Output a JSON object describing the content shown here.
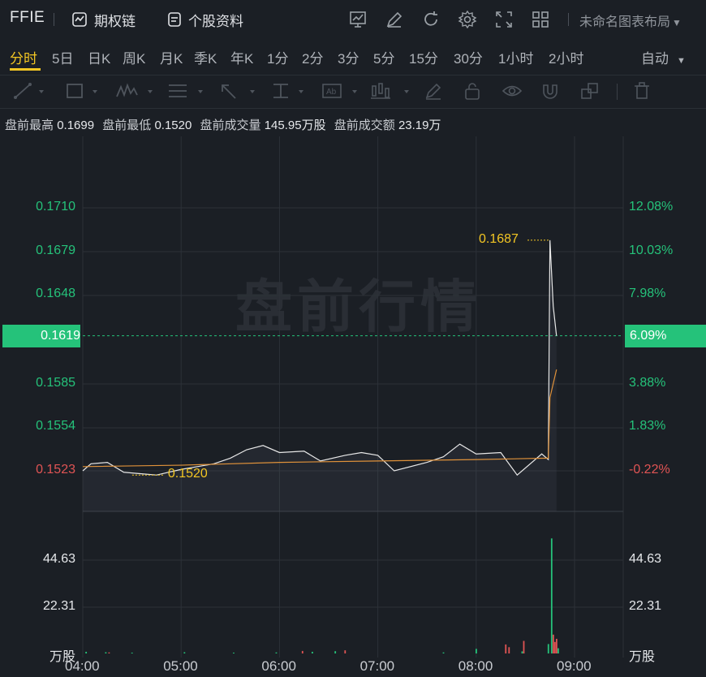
{
  "header": {
    "ticker": "FFIE",
    "options_chain": "期权链",
    "stock_info": "个股资料",
    "layout_name": "未命名图表布局",
    "icons": [
      "indicator-icon",
      "draw-icon",
      "refresh-icon",
      "settings-icon",
      "fullscreen-icon",
      "grid-icon"
    ]
  },
  "tabs": {
    "items": [
      "分时",
      "5日",
      "日K",
      "周K",
      "月K",
      "季K",
      "年K",
      "1分",
      "2分",
      "3分",
      "5分",
      "15分",
      "30分",
      "1小时",
      "2小时"
    ],
    "active": "分时",
    "auto": "自动"
  },
  "info": {
    "high_label": "盘前最高",
    "high": "0.1699",
    "low_label": "盘前最低",
    "low": "0.1520",
    "vol_label": "盘前成交量",
    "vol": "145.95万股",
    "amt_label": "盘前成交额",
    "amt": "23.19万"
  },
  "chart": {
    "watermark": "盘前行情",
    "price_left": [
      "0.1710",
      "0.1679",
      "0.1648",
      "0.1585",
      "0.1554",
      "0.1523"
    ],
    "price_right": [
      "12.08%",
      "10.03%",
      "7.98%",
      "3.88%",
      "1.83%",
      "-0.22%"
    ],
    "current_price": "0.1619",
    "current_pct": "6.09%",
    "high_annotation": "0.1687",
    "low_annotation": "0.1520",
    "vol_left": [
      "44.63",
      "22.31",
      "万股"
    ],
    "vol_right": [
      "44.63",
      "22.31",
      "万股"
    ],
    "x_labels": [
      "04:00",
      "05:00",
      "06:00",
      "07:00",
      "08:00",
      "09:00"
    ],
    "colors": {
      "up": "#25c27a",
      "down": "#e05454",
      "avg": "#e0923a",
      "price": "#e8e8e8",
      "highlight": "#f3c623"
    }
  },
  "chart_data": {
    "type": "line",
    "title": "",
    "x_range": [
      "04:00",
      "09:00"
    ],
    "ylim": [
      0.151,
      0.172
    ],
    "series": [
      {
        "name": "price",
        "points": [
          [
            "04:00",
            0.1523
          ],
          [
            "04:05",
            0.1528
          ],
          [
            "04:15",
            0.1529
          ],
          [
            "04:25",
            0.1522
          ],
          [
            "04:35",
            0.1521
          ],
          [
            "04:45",
            0.152
          ],
          [
            "05:00",
            0.1524
          ],
          [
            "05:20",
            0.1528
          ],
          [
            "05:30",
            0.1532
          ],
          [
            "05:40",
            0.1538
          ],
          [
            "05:50",
            0.1541
          ],
          [
            "06:00",
            0.1536
          ],
          [
            "06:15",
            0.1537
          ],
          [
            "06:25",
            0.153
          ],
          [
            "06:40",
            0.1534
          ],
          [
            "06:50",
            0.1536
          ],
          [
            "07:00",
            0.1534
          ],
          [
            "07:10",
            0.1523
          ],
          [
            "07:30",
            0.1529
          ],
          [
            "07:40",
            0.1533
          ],
          [
            "07:50",
            0.1542
          ],
          [
            "08:00",
            0.1535
          ],
          [
            "08:15",
            0.1536
          ],
          [
            "08:25",
            0.152
          ],
          [
            "08:40",
            0.1535
          ],
          [
            "08:44",
            0.1531
          ],
          [
            "08:45",
            0.1687
          ],
          [
            "08:47",
            0.164
          ],
          [
            "08:49",
            0.1619
          ]
        ]
      },
      {
        "name": "average",
        "points": [
          [
            "04:00",
            0.1526
          ],
          [
            "05:00",
            0.1527
          ],
          [
            "06:00",
            0.1529
          ],
          [
            "07:00",
            0.153
          ],
          [
            "08:00",
            0.1531
          ],
          [
            "08:44",
            0.1532
          ],
          [
            "08:45",
            0.1575
          ],
          [
            "08:49",
            0.1595
          ]
        ]
      }
    ],
    "volume_unit": "万股",
    "volume_ticks": [
      22.31,
      44.63
    ]
  }
}
